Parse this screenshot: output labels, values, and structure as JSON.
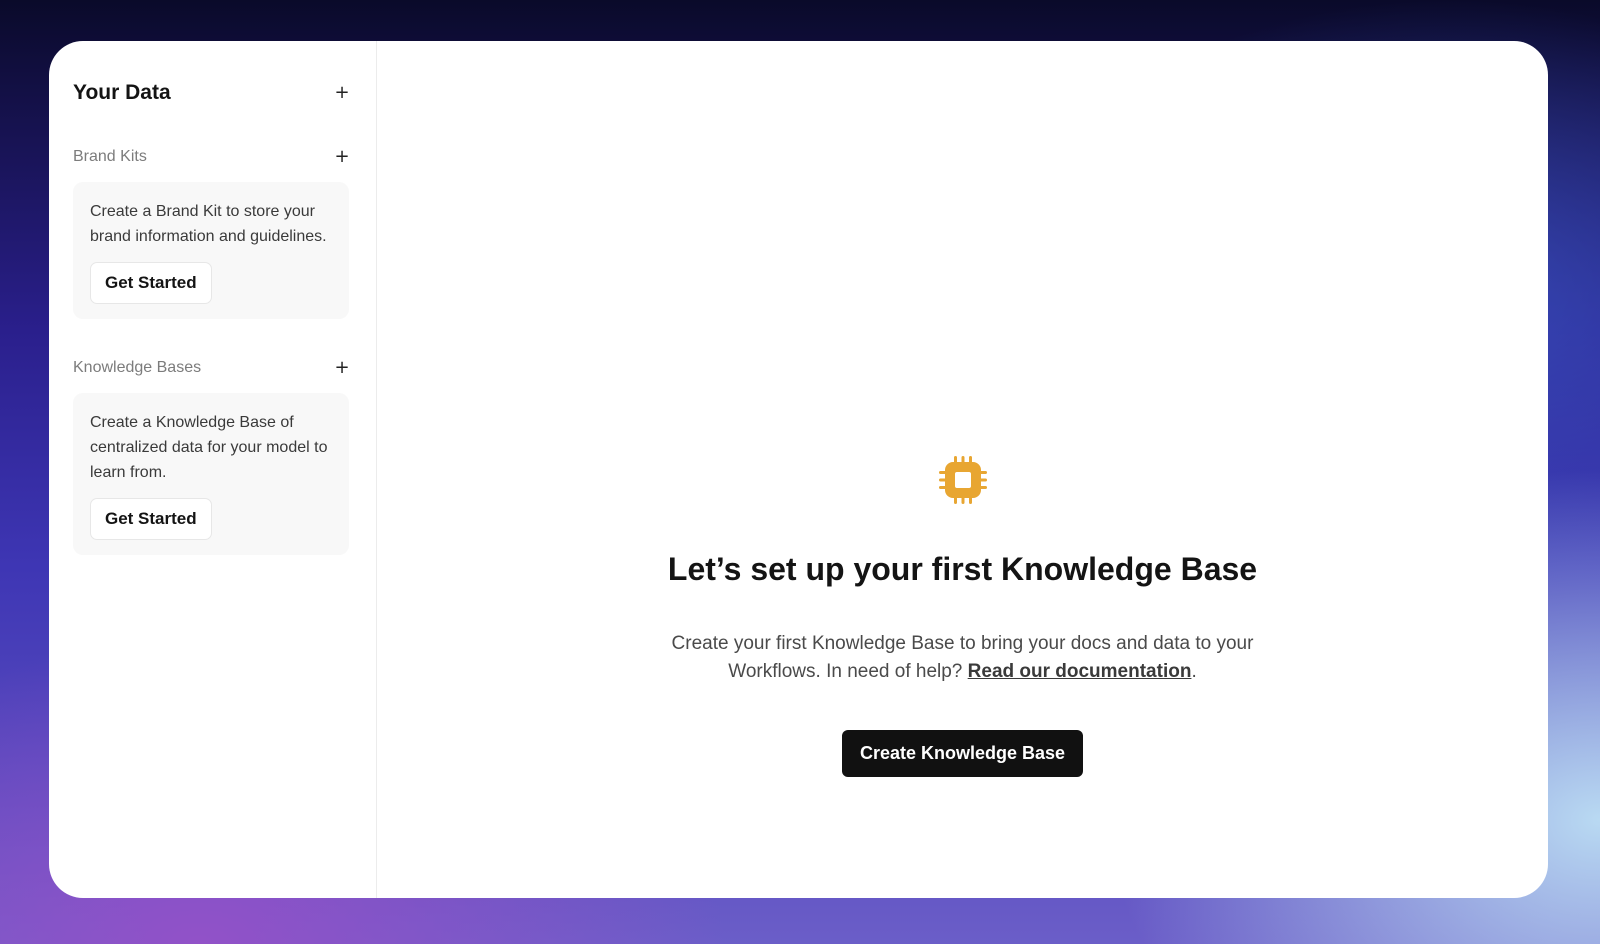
{
  "sidebar": {
    "title": "Your Data",
    "add_icon": "plus-icon",
    "sections": [
      {
        "label": "Brand Kits",
        "description": "Create a Brand Kit to store your brand information and guidelines.",
        "button_label": "Get Started"
      },
      {
        "label": "Knowledge Bases",
        "description": "Create a Knowledge Base of centralized data for your model to learn from.",
        "button_label": "Get Started"
      }
    ],
    "plus_glyph": "+"
  },
  "main": {
    "icon": "cpu-chip-icon",
    "icon_color": "#E8A632",
    "headline": "Let’s set up your first Knowledge Base",
    "subtext_before": "Create your first Knowledge Base to bring your docs and data to your Workflows. In need of help? ",
    "link_label": "Read our documentation",
    "subtext_after": ".",
    "primary_button_label": "Create Knowledge Base"
  }
}
